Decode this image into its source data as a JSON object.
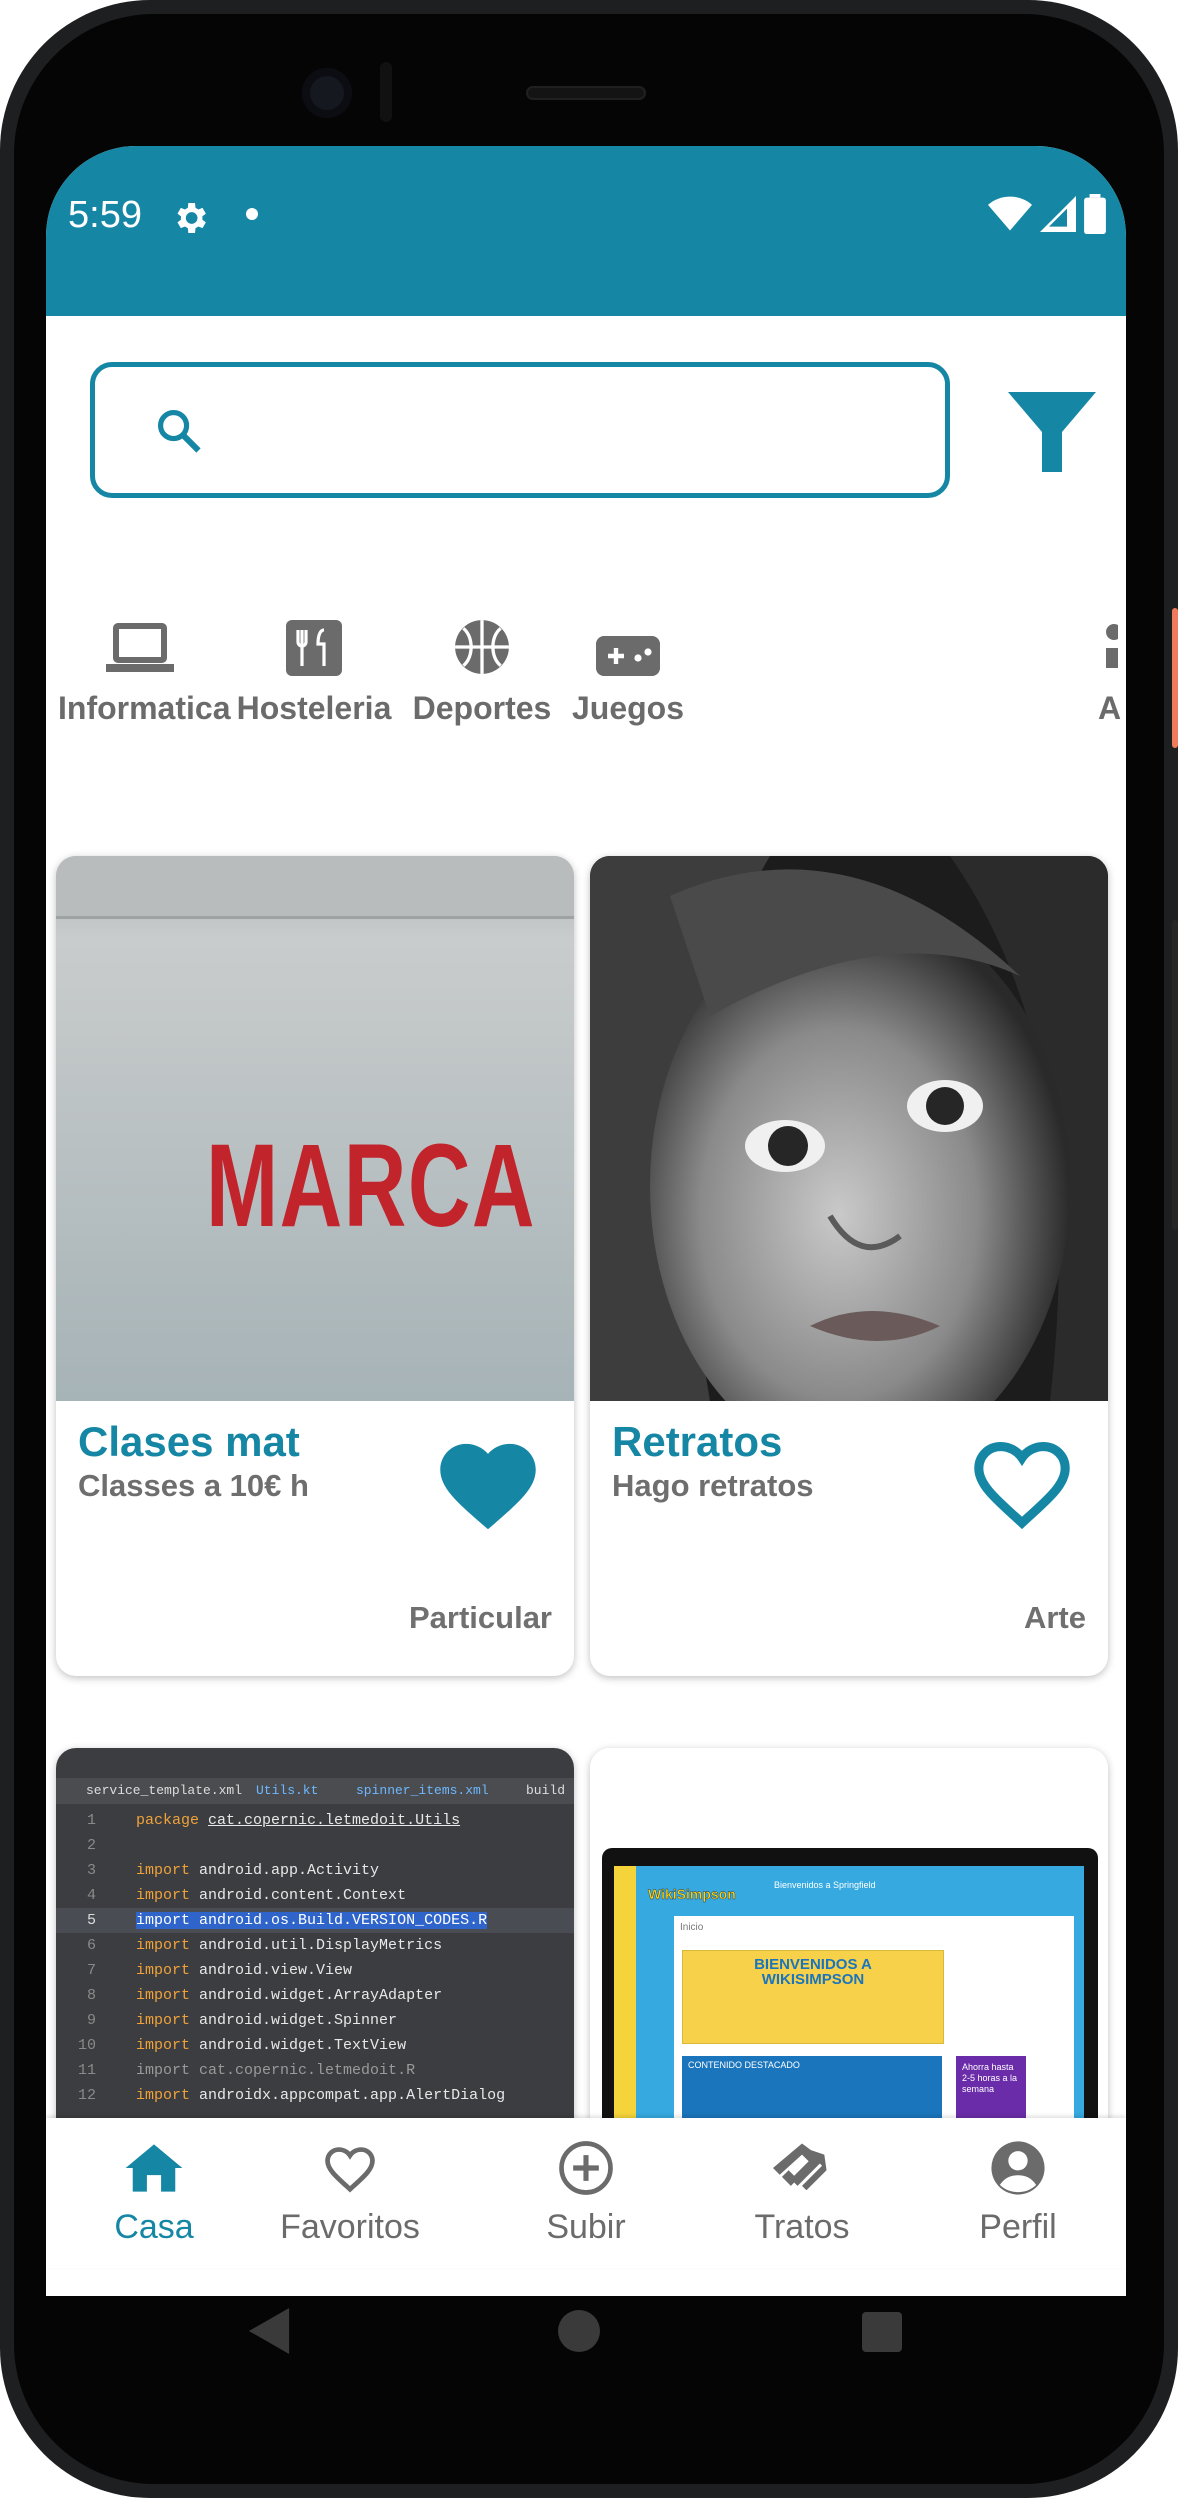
{
  "status": {
    "time": "5:59"
  },
  "search": {
    "placeholder": "",
    "value": ""
  },
  "categories": [
    {
      "label": "Informatica",
      "icon": "laptop-icon"
    },
    {
      "label": "Hosteleria",
      "icon": "restaurant-icon"
    },
    {
      "label": "Deportes",
      "icon": "basketball-icon"
    },
    {
      "label": "Juegos",
      "icon": "gamepad-icon"
    },
    {
      "label": "A",
      "icon": "partial-icon"
    }
  ],
  "cards": [
    {
      "title": "Clases mat",
      "subtitle": "Classes a 10€ h",
      "category": "Particular",
      "favorite": true,
      "image_text": "MARCA"
    },
    {
      "title": "Retratos",
      "subtitle": "Hago retratos",
      "category": "Arte",
      "favorite": false
    }
  ],
  "code_preview": {
    "tabs": [
      "service_template.xml",
      "Utils.kt",
      "spinner_items.xml",
      "build"
    ],
    "lines": [
      {
        "n": "1",
        "kw": "package",
        "text": "cat.copernic.letmedoit.Utils"
      },
      {
        "n": "2",
        "kw": "",
        "text": ""
      },
      {
        "n": "3",
        "kw": "import",
        "text": "android.app.Activity"
      },
      {
        "n": "4",
        "kw": "import",
        "text": "android.content.Context"
      },
      {
        "n": "5",
        "kw": "import",
        "text": "android.os.Build.VERSION_CODES.R"
      },
      {
        "n": "6",
        "kw": "import",
        "text": "android.util.DisplayMetrics"
      },
      {
        "n": "7",
        "kw": "import",
        "text": "android.view.View"
      },
      {
        "n": "8",
        "kw": "import",
        "text": "android.widget.ArrayAdapter"
      },
      {
        "n": "9",
        "kw": "import",
        "text": "android.widget.Spinner"
      },
      {
        "n": "10",
        "kw": "import",
        "text": "android.widget.TextView"
      },
      {
        "n": "11",
        "kw": "import",
        "text": "cat.copernic.letmedoit.R"
      },
      {
        "n": "12",
        "kw": "import",
        "text": "androidx.appcompat.app.AlertDialog"
      }
    ]
  },
  "web_preview": {
    "logo": "WikiSimpson",
    "header": "Bienvenidos a Springfield",
    "tab": "Inicio",
    "banner": "BIENVENIDOS A WIKISIMPSON",
    "section": "CONTENIDO DESTACADO",
    "promo": "Ahorra hasta 2-5 horas a la semana"
  },
  "nav": [
    {
      "label": "Casa",
      "icon": "home-icon",
      "active": true
    },
    {
      "label": "Favoritos",
      "icon": "heart-outline-icon",
      "active": false
    },
    {
      "label": "Subir",
      "icon": "add-circle-icon",
      "active": false
    },
    {
      "label": "Tratos",
      "icon": "handshake-icon",
      "active": false
    },
    {
      "label": "Perfil",
      "icon": "account-icon",
      "active": false
    }
  ],
  "colors": {
    "accent": "#1587a5",
    "text_gray": "#6b6b6b"
  }
}
